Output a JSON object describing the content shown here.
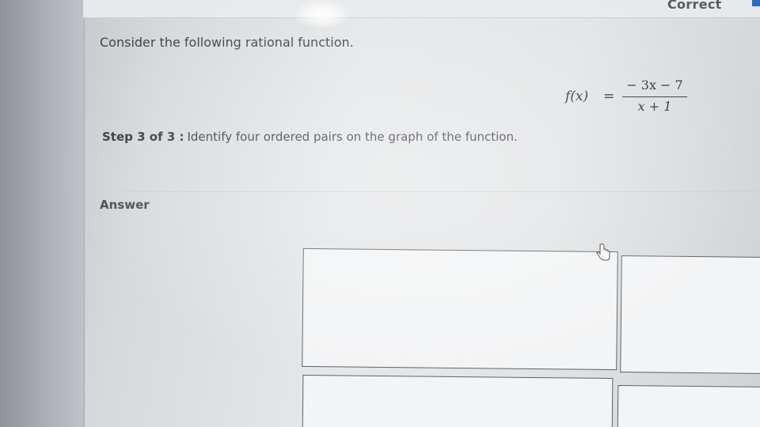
{
  "header": {
    "status_badge": "Correct"
  },
  "question": {
    "intro": "Consider the following rational function.",
    "function": {
      "lhs": "f(x)",
      "equals": "=",
      "numerator": "− 3x − 7",
      "denominator": "x + 1"
    },
    "step": {
      "label": "Step 3 of 3 :",
      "text": "Identify four ordered pairs on the graph of the function."
    }
  },
  "answer": {
    "label": "Answer",
    "fields": [
      {
        "value": ""
      },
      {
        "value": ""
      },
      {
        "value": ""
      },
      {
        "value": ""
      }
    ]
  },
  "icons": {
    "cursor": "hand-pointer-icon"
  },
  "colors": {
    "badge_accent": "#2d6bb8"
  }
}
